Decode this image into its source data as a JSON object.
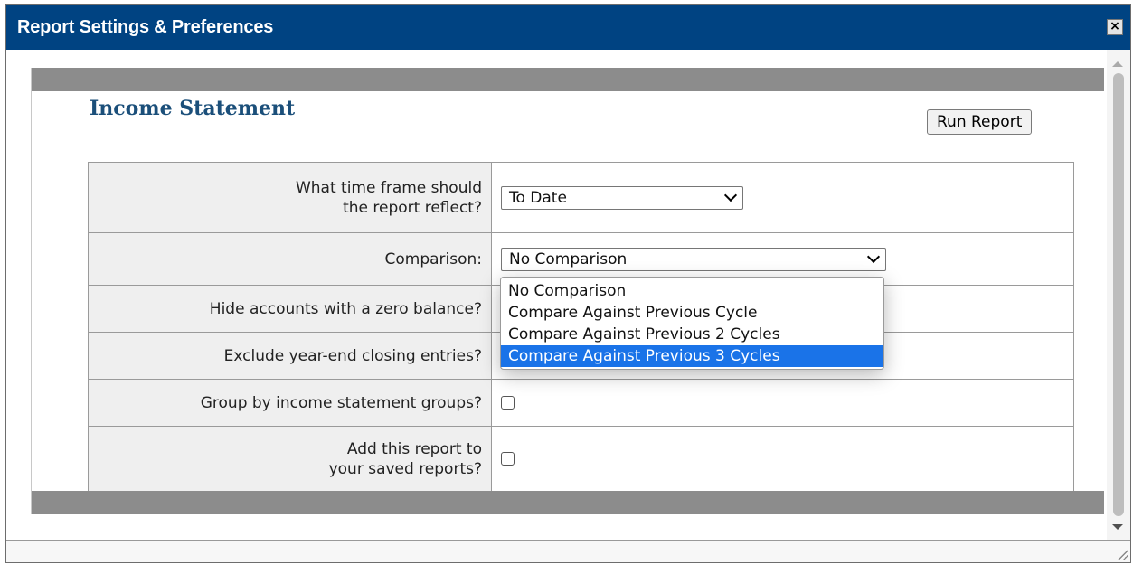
{
  "dialog": {
    "title": "Report Settings & Preferences",
    "close_glyph": "×",
    "colors": {
      "titlebar": "#004382",
      "band": "#8c8c8c",
      "highlight": "#1a73e8",
      "report_title": "#1b4f7a"
    }
  },
  "report": {
    "title": "Income Statement",
    "run_button_label": "Run Report"
  },
  "settings": {
    "time_frame": {
      "label_line1": "What time frame should",
      "label_line2": "the report reflect?",
      "selected": "To Date"
    },
    "comparison": {
      "label": "Comparison:",
      "selected": "No Comparison",
      "options": [
        "No Comparison",
        "Compare Against Previous Cycle",
        "Compare Against Previous 2 Cycles",
        "Compare Against Previous 3 Cycles"
      ],
      "highlighted_option": "Compare Against Previous 3 Cycles"
    },
    "hide_zero": {
      "label": "Hide accounts with a zero balance?",
      "checked": false
    },
    "exclude_closing": {
      "label": "Exclude year-end closing entries?",
      "checked": false
    },
    "group_by": {
      "label": "Group by income statement groups?",
      "checked": false
    },
    "add_saved": {
      "label_line1": "Add this report to",
      "label_line2": "your saved reports?",
      "checked": false
    }
  },
  "icons": [
    "close-icon",
    "chevron-down-icon",
    "scroll-up-icon",
    "scroll-down-icon",
    "resize-grip-icon"
  ]
}
